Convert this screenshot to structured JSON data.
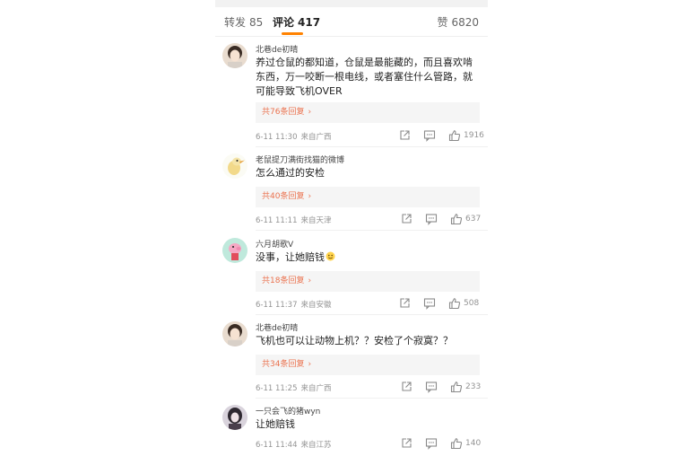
{
  "tabs": {
    "repost": {
      "label": "转发",
      "count": "85"
    },
    "comment": {
      "label": "评论",
      "count": "417"
    },
    "like": {
      "label": "赞",
      "count": "6820"
    }
  },
  "comments": [
    {
      "user": "北巷de初晴",
      "text": "养过仓鼠的都知道，仓鼠是最能藏的，而且喜欢啃东西，万一咬断一根电线，或者塞住什么管路，就可能导致飞机OVER",
      "replies": "共76条回复",
      "time": "6-11 11:30",
      "location": "来自广西",
      "likes": "1916"
    },
    {
      "user": "老鼠提刀满街找猫的微博",
      "text": "怎么通过的安检",
      "replies": "共40条回复",
      "time": "6-11 11:11",
      "location": "来自天津",
      "likes": "637"
    },
    {
      "user": "六月胡歌V",
      "text": "没事，让她赔钱",
      "replies": "共18条回复",
      "time": "6-11 11:37",
      "location": "来自安徽",
      "likes": "508"
    },
    {
      "user": "北巷de初晴",
      "text": "飞机也可以让动物上机？？安检了个寂寞？？",
      "replies": "共34条回复",
      "time": "6-11 11:25",
      "location": "来自广西",
      "likes": "233"
    },
    {
      "user": "一只会飞的猪wyn",
      "text": "让她赔钱",
      "time": "6-11 11:44",
      "location": "来自江苏",
      "likes": "140"
    }
  ],
  "icons": {
    "share": "share-icon",
    "comment": "comment-icon",
    "like": "thumbs-up-icon",
    "emoji": "smile-emoji-icon",
    "chevron": "chevron-right-icon"
  },
  "colors": {
    "accent_underline": "#ff8200",
    "reply_link": "#eb7350",
    "meta_text": "#939393"
  }
}
